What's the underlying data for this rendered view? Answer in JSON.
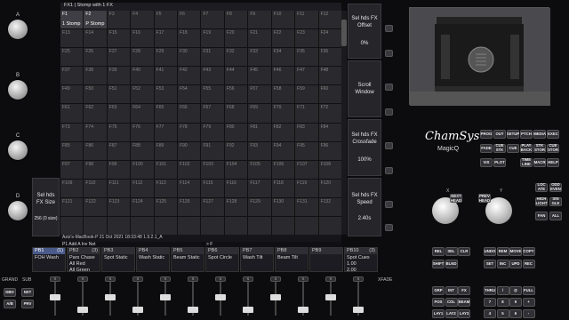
{
  "encoders": [
    {
      "label": "A"
    },
    {
      "label": "B"
    },
    {
      "label": "C"
    },
    {
      "label": "D"
    }
  ],
  "left_panels": [
    {
      "label": "Sel hds FX Size",
      "value": "256 (0 size)"
    }
  ],
  "right_panels": [
    {
      "label": "Sel hds FX Offset",
      "value": "0%"
    },
    {
      "label": "Scroll Window",
      "value": ""
    },
    {
      "label": "Sel hds FX Crossfade",
      "value": "100%"
    },
    {
      "label": "Sel hds FX Speed",
      "value": "2.40s"
    }
  ],
  "window_title": "FX1 | Stomp with 1 FX",
  "cells": [
    [
      "F1",
      "F2",
      "F3",
      "F4",
      "F5",
      "F6",
      "F7",
      "F8",
      "F9",
      "F10",
      "F11",
      "F12"
    ],
    [
      "F13",
      "F14",
      "F15",
      "F16",
      "F17",
      "F18",
      "F19",
      "F20",
      "F21",
      "F22",
      "F23",
      "F24"
    ],
    [
      "F25",
      "F26",
      "F27",
      "F28",
      "F29",
      "F30",
      "F31",
      "F32",
      "F33",
      "F34",
      "F35",
      "F36"
    ],
    [
      "F37",
      "F38",
      "F39",
      "F40",
      "F41",
      "F42",
      "F43",
      "F44",
      "F45",
      "F46",
      "F47",
      "F48"
    ],
    [
      "F49",
      "F50",
      "F51",
      "F52",
      "F53",
      "F54",
      "F55",
      "F56",
      "F57",
      "F58",
      "F59",
      "F60"
    ],
    [
      "F61",
      "F62",
      "F63",
      "F64",
      "F65",
      "F66",
      "F67",
      "F68",
      "F69",
      "F70",
      "F71",
      "F72"
    ],
    [
      "F73",
      "F74",
      "F75",
      "F76",
      "F77",
      "F78",
      "F79",
      "F80",
      "F81",
      "F82",
      "F83",
      "F84"
    ],
    [
      "F85",
      "F86",
      "F87",
      "F88",
      "F89",
      "F90",
      "F91",
      "F92",
      "F93",
      "F94",
      "F95",
      "F96"
    ],
    [
      "F97",
      "F98",
      "F99",
      "F100",
      "F101",
      "F102",
      "F103",
      "F104",
      "F105",
      "F106",
      "F107",
      "F108"
    ],
    [
      "F109",
      "F110",
      "F111",
      "F112",
      "F113",
      "F114",
      "F115",
      "F116",
      "F117",
      "F118",
      "F119",
      "F120"
    ],
    [
      "F121",
      "F122",
      "F123",
      "F124",
      "F125",
      "F126",
      "F127",
      "F128",
      "F129",
      "F130",
      "F131",
      "F132"
    ]
  ],
  "cell_names": {
    "F1": "1 Stomp",
    "F2": "P Stomp"
  },
  "status_line": "Aziz's-MacBook-P 21 Oct 2021 18:33:48 1.9.2.1_A",
  "status_line2": "P1  Add A Inv Net",
  "cmd_prompt": "> F",
  "playbacks": [
    {
      "id": "PB1",
      "count": "(1)",
      "name": "FOH Wash",
      "active": true
    },
    {
      "id": "PB2",
      "count": "(3)",
      "name": "Pars Chase\nAll Red\nAll Green",
      "active": false
    },
    {
      "id": "PB3",
      "count": "",
      "name": "Spot Static",
      "active": false
    },
    {
      "id": "PB4",
      "count": "",
      "name": "Wash Static",
      "active": false
    },
    {
      "id": "PB5",
      "count": "",
      "name": "Beam Static",
      "active": false
    },
    {
      "id": "PB6",
      "count": "",
      "name": "Spot Circle",
      "active": false
    },
    {
      "id": "PB7",
      "count": "",
      "name": "Wash Tilt",
      "active": false
    },
    {
      "id": "PB8",
      "count": "",
      "name": "Beam Tilt",
      "active": false
    },
    {
      "id": "PB9",
      "count": "",
      "name": "",
      "active": false
    },
    {
      "id": "PB10",
      "count": "(3)",
      "name": "Spot Cues\n1.00\n2.00",
      "active": false
    }
  ],
  "brand": "ChamSys",
  "product": "MagicQ",
  "row_labels": {
    "grand": "GRAND",
    "sub": "SUB",
    "xfade": "XFADE"
  },
  "keys_top": [
    [
      "PROG",
      "OUT",
      "SETUP",
      "PTCH",
      "MEDIA",
      "EXEC"
    ],
    [
      "FADE",
      "CUE STK",
      "CUE",
      "PLAY BACK",
      "STK STOR",
      "CUE STOR"
    ],
    [
      "VIS",
      "PLOT",
      "",
      "TIME LINE",
      "MACR",
      "HELP"
    ]
  ],
  "keys_right": [
    [
      "LOC ATE",
      "ODD EVEN"
    ],
    [
      "HIGH LIGHT",
      "SIN GLE"
    ],
    [
      "FAN",
      "ALL"
    ]
  ],
  "keys_cmd": [
    [
      "REL",
      "SEL",
      "CLR",
      "",
      "UNDO",
      "REM",
      "MOVE",
      "COPY"
    ],
    [
      "SHIFT",
      "BLND",
      "",
      "",
      "SET",
      "INC",
      "UPD",
      "REC"
    ]
  ],
  "keys_bottom": [
    [
      "GRP",
      "INT",
      "FX",
      "",
      "THRU",
      "/",
      "@",
      "FULL"
    ],
    [
      "POS",
      "COL",
      "BEAM",
      "",
      "7",
      "8",
      "9",
      "+"
    ],
    [
      "LAY1",
      "LAY2",
      "LAY3",
      "",
      "4",
      "5",
      "6",
      "-"
    ]
  ],
  "left_keys": [
    [
      "DBO",
      "NXT"
    ],
    [
      "A/B",
      "PRV"
    ]
  ],
  "small_head": [
    "NEXT HEAD",
    "PREV HEAD"
  ],
  "enc_xy": [
    "X",
    "Y"
  ],
  "fader_btns": "S"
}
